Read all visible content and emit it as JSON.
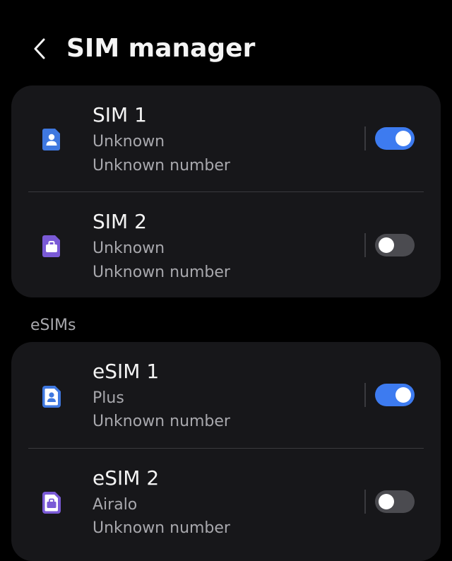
{
  "header": {
    "title": "SIM manager",
    "back_icon": "chevron-left-icon"
  },
  "colors": {
    "background": "#000000",
    "card": "#17171a",
    "toggle_on": "#3d7bf0",
    "toggle_off": "#4b4b50",
    "sim1_icon": "#3f78e0",
    "sim2_icon": "#7a5ad6"
  },
  "physical_sims": [
    {
      "name": "SIM 1",
      "carrier": "Unknown",
      "number": "Unknown number",
      "enabled": true,
      "icon": "sim-person-icon"
    },
    {
      "name": "SIM 2",
      "carrier": "Unknown",
      "number": "Unknown number",
      "enabled": false,
      "icon": "sim-briefcase-icon"
    }
  ],
  "esims_section": {
    "label": "eSIMs"
  },
  "esims": [
    {
      "name": "eSIM 1",
      "carrier": "Plus",
      "number": "Unknown number",
      "enabled": true,
      "icon": "esim-person-icon"
    },
    {
      "name": "eSIM 2",
      "carrier": "Airalo",
      "number": "Unknown number",
      "enabled": false,
      "icon": "esim-briefcase-icon"
    }
  ]
}
